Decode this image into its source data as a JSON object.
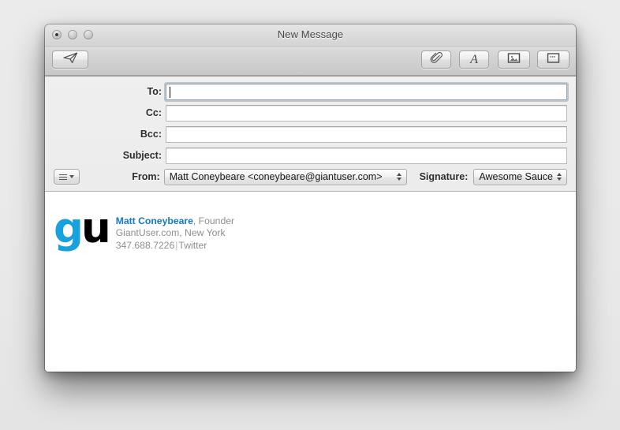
{
  "window": {
    "title": "New Message",
    "traffic_lights": [
      {
        "name": "close",
        "has_dot": true
      },
      {
        "name": "minimize",
        "has_dot": false
      },
      {
        "name": "zoom",
        "has_dot": false
      }
    ]
  },
  "toolbar": {
    "send": {
      "label": "",
      "icon": "paper-plane-icon"
    },
    "attach": {
      "label": "",
      "icon": "paperclip-icon"
    },
    "fonts": {
      "label": "A",
      "icon": "font-icon"
    },
    "photo_browser": {
      "label": "",
      "icon": "photo-icon"
    },
    "stationery": {
      "label": "",
      "icon": "stationery-icon"
    }
  },
  "headers": {
    "fields": [
      {
        "label": "To:",
        "value": "",
        "focused": true
      },
      {
        "label": "Cc:",
        "value": "",
        "focused": false
      },
      {
        "label": "Bcc:",
        "value": "",
        "focused": false
      },
      {
        "label": "Subject:",
        "value": "",
        "focused": false
      }
    ],
    "header_menu_icon": "hamburger-menu-icon",
    "from_label": "From:",
    "from_value": "Matt Coneybeare <coneybeare@giantuser.com>",
    "signature_label": "Signature:",
    "signature_value": "Awesome Sauce"
  },
  "body": {
    "logo": {
      "first": "g",
      "second": "u"
    },
    "signature": {
      "name": "Matt Coneybeare",
      "title": ", Founder",
      "line2": "GiantUser.com, New York",
      "phone": "347.688.7226",
      "separator": "|",
      "social": "Twitter"
    }
  },
  "colors": {
    "logo_blue": "#19a1de",
    "name_blue": "#1679c0",
    "muted_gray": "#8e8e8e"
  }
}
